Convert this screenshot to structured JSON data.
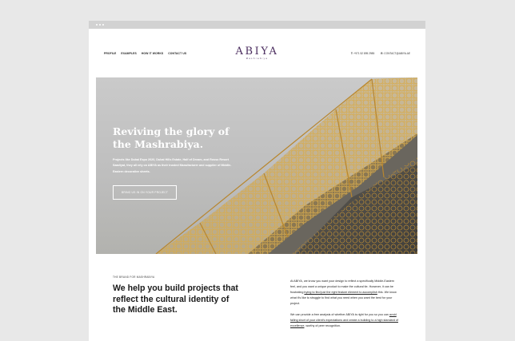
{
  "nav": {
    "links": [
      "PROFILE",
      "EXAMPLES",
      "HOW IT WORKS",
      "CONTACT US"
    ],
    "logo": "ABIYA",
    "logo_sub": "Mashrabiya",
    "phone_label": "T:",
    "phone": "+971 52 895 2985",
    "email_label": "E:",
    "email": "CONTACT@ABIYA.AE"
  },
  "hero": {
    "title_line1": "Reviving the glory of",
    "title_line2": "the Mashrabiya.",
    "text": "Projects like Dubai Expo 2020, Dubai Hills Estate, Half of Dream, and Rosso Resort Saadiyat, they all rely on ABIYA as their trusted Manufacturer and supplier of Middle-Eastern decorative sheets.",
    "button": "BRING US IN ON YOUR PROJECT"
  },
  "intro": {
    "eyebrow": "THE BRAND FOR MASHRABIYA",
    "headline": "We help you build projects that reflect the cultural identity of the Middle East.",
    "p1_a": "At ABIYA, we know you want your design to reflect a specifically Middle-Eastern feel, and you want a unique product to make the cultural tie. However, it can be frustrating ",
    "p1_link": "trying to find just the right feature element to accomplish",
    "p1_b": " this. We know what it's like to struggle to find what you need when you want the best for your project.",
    "p2_a": "We can provide a free analysis of whether ABIYA is right for you so you can ",
    "p2_link": "avoid falling short of your client's expectations and create a building to a high standard of excellence",
    "p2_b": ", worthy of peer recognition."
  },
  "colors": {
    "brand": "#4b2d5f",
    "hero_sky": "#c4c4c4",
    "screen_gold": "#c99a3c",
    "page_bg": "#e8e8e8"
  }
}
